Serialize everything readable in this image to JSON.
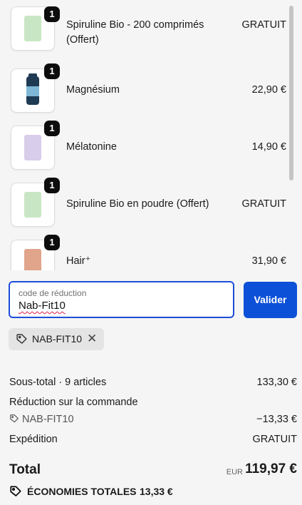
{
  "items": [
    {
      "name": "Spiruline Bio - 200 comprimés (Offert)",
      "price": "GRATUIT",
      "qty": "1",
      "color": "#c9e6c4"
    },
    {
      "name": "Magnésium",
      "price": "22,90 €",
      "qty": "1",
      "color": "#1f3b54"
    },
    {
      "name": "Mélatonine",
      "price": "14,90 €",
      "qty": "1",
      "color": "#d8cdea"
    },
    {
      "name": "Spiruline Bio en poudre (Offert)",
      "price": "GRATUIT",
      "qty": "1",
      "color": "#c9e6c4"
    },
    {
      "name": "Hair⁺",
      "price": "31,90 €",
      "qty": "1",
      "color": "#e0a58a"
    }
  ],
  "discount": {
    "label": "code de réduction",
    "value": "Nab-Fit10",
    "apply_label": "Valider",
    "applied_code": "NAB-FIT10"
  },
  "summary": {
    "subtotal_label": "Sous-total · 9 articles",
    "subtotal_value": "133,30 €",
    "order_discount_label": "Réduction sur la commande",
    "order_discount_code": "NAB-FIT10",
    "order_discount_value": "−13,33 €",
    "shipping_label": "Expédition",
    "shipping_value": "GRATUIT",
    "total_label": "Total",
    "currency": "EUR",
    "total_value": "119,97 €",
    "savings_label": "ÉCONOMIES TOTALES",
    "savings_value": "13,33 €"
  },
  "colors": {
    "accent": "#0c50d8",
    "input_border": "#1d4ed8"
  }
}
